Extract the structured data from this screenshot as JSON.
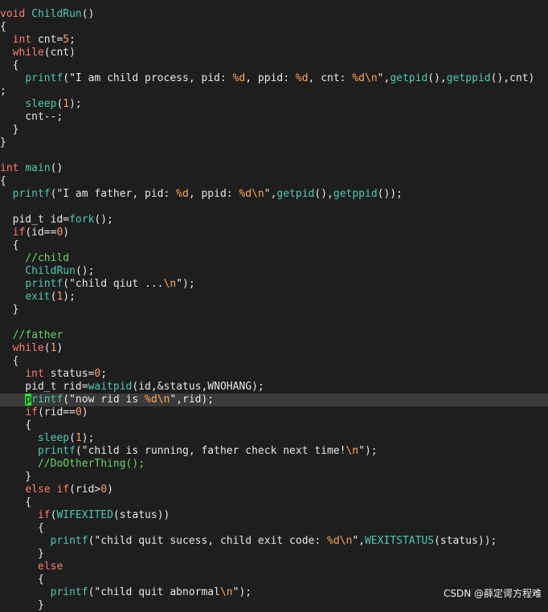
{
  "editor": {
    "current_line_index": 30,
    "lines": [
      [
        [
          "type",
          "void"
        ],
        [
          "plain",
          " "
        ],
        [
          "fn",
          "ChildRun"
        ],
        [
          "plain",
          "()"
        ]
      ],
      [
        [
          "plain",
          "{"
        ]
      ],
      [
        [
          "plain",
          "  "
        ],
        [
          "type",
          "int"
        ],
        [
          "plain",
          " cnt="
        ],
        [
          "num",
          "5"
        ],
        [
          "plain",
          ";"
        ]
      ],
      [
        [
          "plain",
          "  "
        ],
        [
          "kw",
          "while"
        ],
        [
          "plain",
          "(cnt)"
        ]
      ],
      [
        [
          "plain",
          "  {"
        ]
      ],
      [
        [
          "plain",
          "    "
        ],
        [
          "fn",
          "printf"
        ],
        [
          "plain",
          "(\"I am child process, pid: "
        ],
        [
          "fmt",
          "%d"
        ],
        [
          "plain",
          ", ppid: "
        ],
        [
          "fmt",
          "%d"
        ],
        [
          "plain",
          ", cnt: "
        ],
        [
          "fmt",
          "%d\\n"
        ],
        [
          "plain",
          "\","
        ],
        [
          "fn",
          "getpid"
        ],
        [
          "plain",
          "(),"
        ],
        [
          "fn",
          "getppid"
        ],
        [
          "plain",
          "(),cnt)"
        ]
      ],
      [
        [
          "plain",
          ";"
        ]
      ],
      [
        [
          "plain",
          "    "
        ],
        [
          "fn",
          "sleep"
        ],
        [
          "plain",
          "("
        ],
        [
          "num",
          "1"
        ],
        [
          "plain",
          ");"
        ]
      ],
      [
        [
          "plain",
          "    cnt--;"
        ]
      ],
      [
        [
          "plain",
          "  }"
        ]
      ],
      [
        [
          "plain",
          "}"
        ]
      ],
      [],
      [
        [
          "type",
          "int"
        ],
        [
          "plain",
          " "
        ],
        [
          "fn",
          "main"
        ],
        [
          "plain",
          "()"
        ]
      ],
      [
        [
          "plain",
          "{"
        ]
      ],
      [
        [
          "plain",
          "  "
        ],
        [
          "fn",
          "printf"
        ],
        [
          "plain",
          "(\"I am father, pid: "
        ],
        [
          "fmt",
          "%d"
        ],
        [
          "plain",
          ", ppid: "
        ],
        [
          "fmt",
          "%d\\n"
        ],
        [
          "plain",
          "\","
        ],
        [
          "fn",
          "getpid"
        ],
        [
          "plain",
          "(),"
        ],
        [
          "fn",
          "getppid"
        ],
        [
          "plain",
          "());"
        ]
      ],
      [],
      [
        [
          "plain",
          "  pid_t id="
        ],
        [
          "fn",
          "fork"
        ],
        [
          "plain",
          "();"
        ]
      ],
      [
        [
          "plain",
          "  "
        ],
        [
          "kw",
          "if"
        ],
        [
          "plain",
          "(id=="
        ],
        [
          "num",
          "0"
        ],
        [
          "plain",
          ")"
        ]
      ],
      [
        [
          "plain",
          "  {"
        ]
      ],
      [
        [
          "plain",
          "    "
        ],
        [
          "comment",
          "//child"
        ]
      ],
      [
        [
          "plain",
          "    "
        ],
        [
          "fn",
          "ChildRun"
        ],
        [
          "plain",
          "();"
        ]
      ],
      [
        [
          "plain",
          "    "
        ],
        [
          "fn",
          "printf"
        ],
        [
          "plain",
          "(\"child qiut ..."
        ],
        [
          "fmt",
          "\\n"
        ],
        [
          "plain",
          "\");"
        ]
      ],
      [
        [
          "plain",
          "    "
        ],
        [
          "fn",
          "exit"
        ],
        [
          "plain",
          "("
        ],
        [
          "num",
          "1"
        ],
        [
          "plain",
          ");"
        ]
      ],
      [
        [
          "plain",
          "  }"
        ]
      ],
      [],
      [
        [
          "plain",
          "  "
        ],
        [
          "comment",
          "//father"
        ]
      ],
      [
        [
          "plain",
          "  "
        ],
        [
          "kw",
          "while"
        ],
        [
          "plain",
          "("
        ],
        [
          "num",
          "1"
        ],
        [
          "plain",
          ")"
        ]
      ],
      [
        [
          "plain",
          "  {"
        ]
      ],
      [
        [
          "plain",
          "    "
        ],
        [
          "type",
          "int"
        ],
        [
          "plain",
          " status="
        ],
        [
          "num",
          "0"
        ],
        [
          "plain",
          ";"
        ]
      ],
      [
        [
          "plain",
          "    pid_t rid="
        ],
        [
          "fn",
          "waitpid"
        ],
        [
          "plain",
          "(id,&status,WNOHANG);"
        ]
      ],
      [
        [
          "plain",
          "    "
        ],
        [
          "cursor",
          "p"
        ],
        [
          "fn",
          "rintf"
        ],
        [
          "plain",
          "(\"now rid is "
        ],
        [
          "fmt",
          "%d\\n"
        ],
        [
          "plain",
          "\",rid);"
        ]
      ],
      [
        [
          "plain",
          "    "
        ],
        [
          "kw",
          "if"
        ],
        [
          "plain",
          "(rid=="
        ],
        [
          "num",
          "0"
        ],
        [
          "plain",
          ")"
        ]
      ],
      [
        [
          "plain",
          "    {"
        ]
      ],
      [
        [
          "plain",
          "      "
        ],
        [
          "fn",
          "sleep"
        ],
        [
          "plain",
          "("
        ],
        [
          "num",
          "1"
        ],
        [
          "plain",
          ");"
        ]
      ],
      [
        [
          "plain",
          "      "
        ],
        [
          "fn",
          "printf"
        ],
        [
          "plain",
          "(\"child is running, father check next time!"
        ],
        [
          "fmt",
          "\\n"
        ],
        [
          "plain",
          "\");"
        ]
      ],
      [
        [
          "plain",
          "      "
        ],
        [
          "comment",
          "//DoOtherThing();"
        ]
      ],
      [
        [
          "plain",
          "    }"
        ]
      ],
      [
        [
          "plain",
          "    "
        ],
        [
          "kw",
          "else"
        ],
        [
          "plain",
          " "
        ],
        [
          "kw",
          "if"
        ],
        [
          "plain",
          "(rid>"
        ],
        [
          "num",
          "0"
        ],
        [
          "plain",
          ")"
        ]
      ],
      [
        [
          "plain",
          "    {"
        ]
      ],
      [
        [
          "plain",
          "      "
        ],
        [
          "kw",
          "if"
        ],
        [
          "plain",
          "("
        ],
        [
          "fn",
          "WIFEXITED"
        ],
        [
          "plain",
          "(status))"
        ]
      ],
      [
        [
          "plain",
          "      {"
        ]
      ],
      [
        [
          "plain",
          "        "
        ],
        [
          "fn",
          "printf"
        ],
        [
          "plain",
          "(\"child quit sucess, child exit code: "
        ],
        [
          "fmt",
          "%d\\n"
        ],
        [
          "plain",
          "\","
        ],
        [
          "fn",
          "WEXITSTATUS"
        ],
        [
          "plain",
          "(status));"
        ]
      ],
      [
        [
          "plain",
          "      }"
        ]
      ],
      [
        [
          "plain",
          "      "
        ],
        [
          "kw",
          "else"
        ]
      ],
      [
        [
          "plain",
          "      {"
        ]
      ],
      [
        [
          "plain",
          "        "
        ],
        [
          "fn",
          "printf"
        ],
        [
          "plain",
          "(\"child quit abnormal"
        ],
        [
          "fmt",
          "\\n"
        ],
        [
          "plain",
          "\");"
        ]
      ],
      [
        [
          "plain",
          "      }"
        ]
      ]
    ]
  },
  "watermark": "CSDN @薛定谔方程难"
}
